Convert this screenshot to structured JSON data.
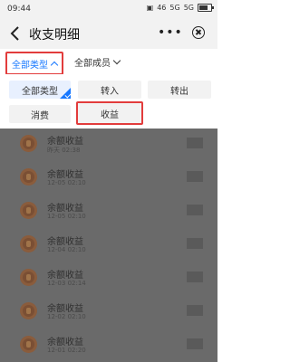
{
  "status_bar": {
    "time": "09:44",
    "signal_labels": [
      "46",
      "5G",
      "5G"
    ],
    "battery_label": ""
  },
  "nav": {
    "title": "收支明细",
    "more_label": "•••"
  },
  "filters": {
    "type_label": "全部类型",
    "member_label": "全部成员"
  },
  "options": [
    {
      "label": "全部类型",
      "selected": true
    },
    {
      "label": "转入",
      "selected": false
    },
    {
      "label": "转出",
      "selected": false
    },
    {
      "label": "消费",
      "selected": false
    },
    {
      "label": "收益",
      "selected": false,
      "highlighted": true
    }
  ],
  "records": [
    {
      "label": "余额收益",
      "time": "昨天 02:38"
    },
    {
      "label": "余额收益",
      "time": "12-05 02:10"
    },
    {
      "label": "余额收益",
      "time": "12-05 02:10"
    },
    {
      "label": "余额收益",
      "time": "12-04 02:10"
    },
    {
      "label": "余额收益",
      "time": "12-03 02:14"
    },
    {
      "label": "余额收益",
      "time": "12-02 02:10"
    },
    {
      "label": "余额收益",
      "time": "12-01 02:20"
    }
  ],
  "colors": {
    "accent": "#1677ff",
    "highlight_border": "#e23c3c",
    "overlay": "#6a6a6a"
  }
}
